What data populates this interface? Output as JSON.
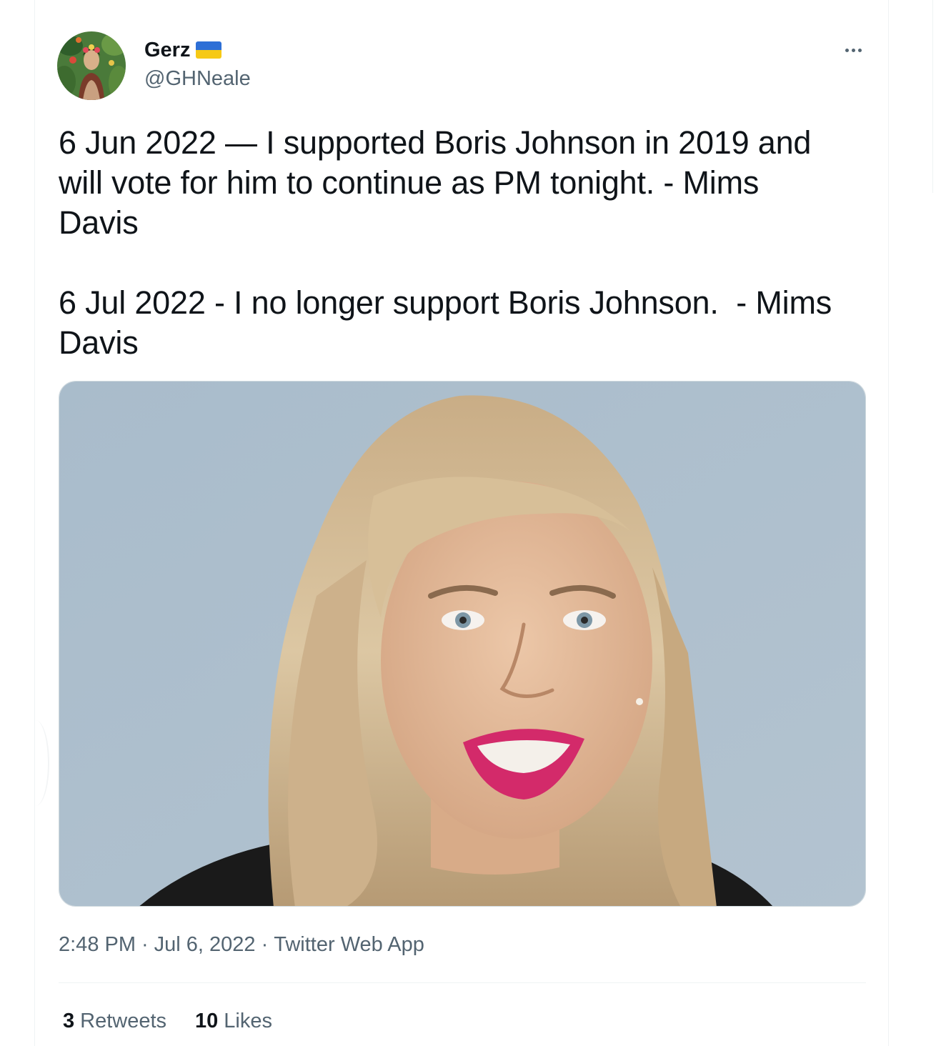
{
  "author": {
    "display_name": "Gerz",
    "handle": "@GHNeale",
    "flag_emoji_icon": "ukraine-flag-icon",
    "avatar_icon": "profile-avatar"
  },
  "tweet": {
    "text": "6 Jun 2022 — I supported Boris Johnson in 2019 and\nwill vote for him to continue as PM tonight. - Mims\nDavis\n\n6 Jul 2022 - I no longer support Boris Johnson.  - Mims\nDavis",
    "media_description_icon": "tweet-photo"
  },
  "meta": {
    "time": "2:48 PM",
    "separator": "·",
    "date": "Jul 6, 2022",
    "source": "Twitter Web App"
  },
  "stats": {
    "retweets_count": "3",
    "retweets_label": "Retweets",
    "likes_count": "10",
    "likes_label": "Likes"
  },
  "colors": {
    "text_primary": "#0f1419",
    "text_secondary": "#536471",
    "border": "#eff3f4",
    "flag_blue": "#2d6fd6",
    "flag_yellow": "#f6c915"
  }
}
